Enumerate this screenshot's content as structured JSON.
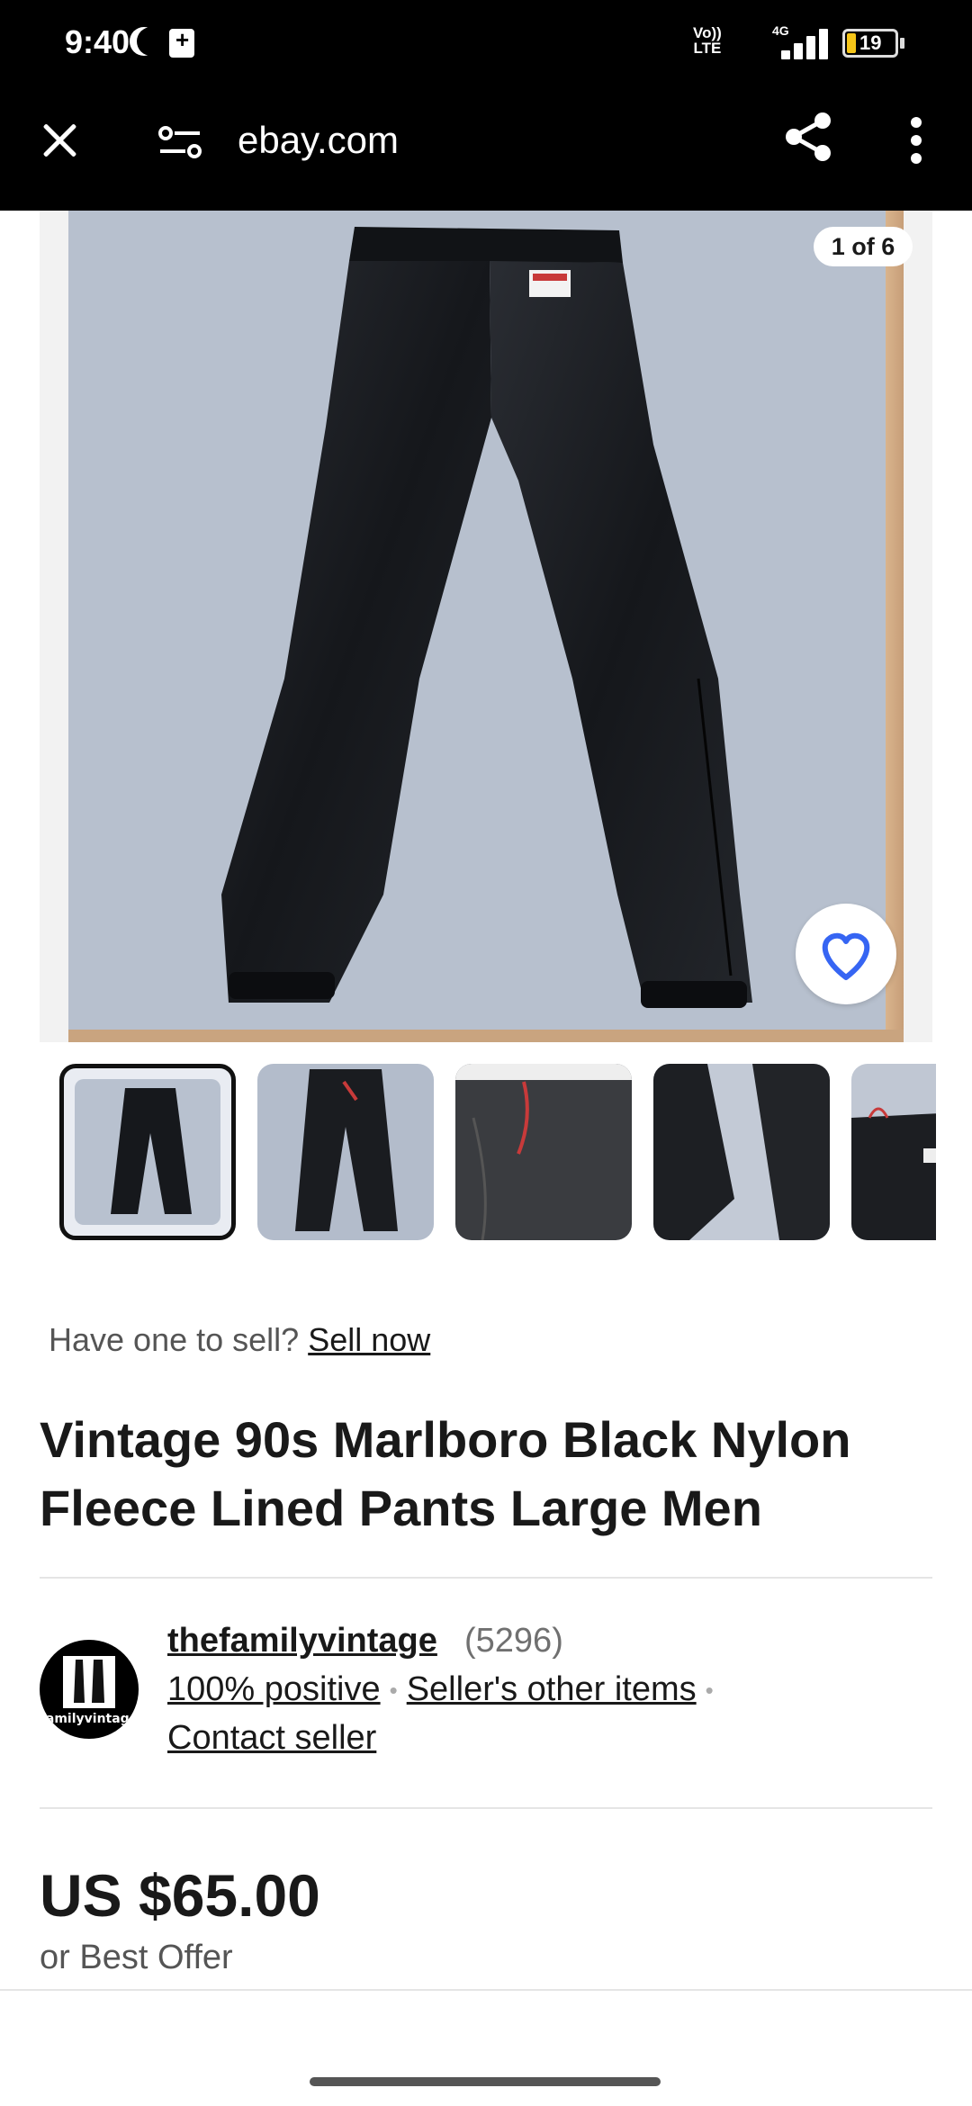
{
  "status_bar": {
    "time": "9:40",
    "volte_line1": "Vo))",
    "volte_line2": "LTE",
    "network": "4G",
    "battery": "19"
  },
  "browser": {
    "url": "ebay.com"
  },
  "gallery": {
    "counter": "1 of 6",
    "thumbnail_count": 5
  },
  "sell_prompt": {
    "text": "Have one to sell?",
    "link": "Sell now"
  },
  "listing": {
    "title": "Vintage 90s Marlboro Black Nylon Fleece Lined Pants Large Men",
    "price": "US $65.00",
    "offer": "or Best Offer"
  },
  "seller": {
    "name": "thefamilyvintage",
    "feedback_count": "(5296)",
    "positive": "100% positive",
    "other_items": "Seller's other items",
    "contact": "Contact seller",
    "avatar_text": "familyvintage"
  },
  "colors": {
    "accent_heart": "#3665f3",
    "text": "#191919",
    "muted": "#707070"
  }
}
